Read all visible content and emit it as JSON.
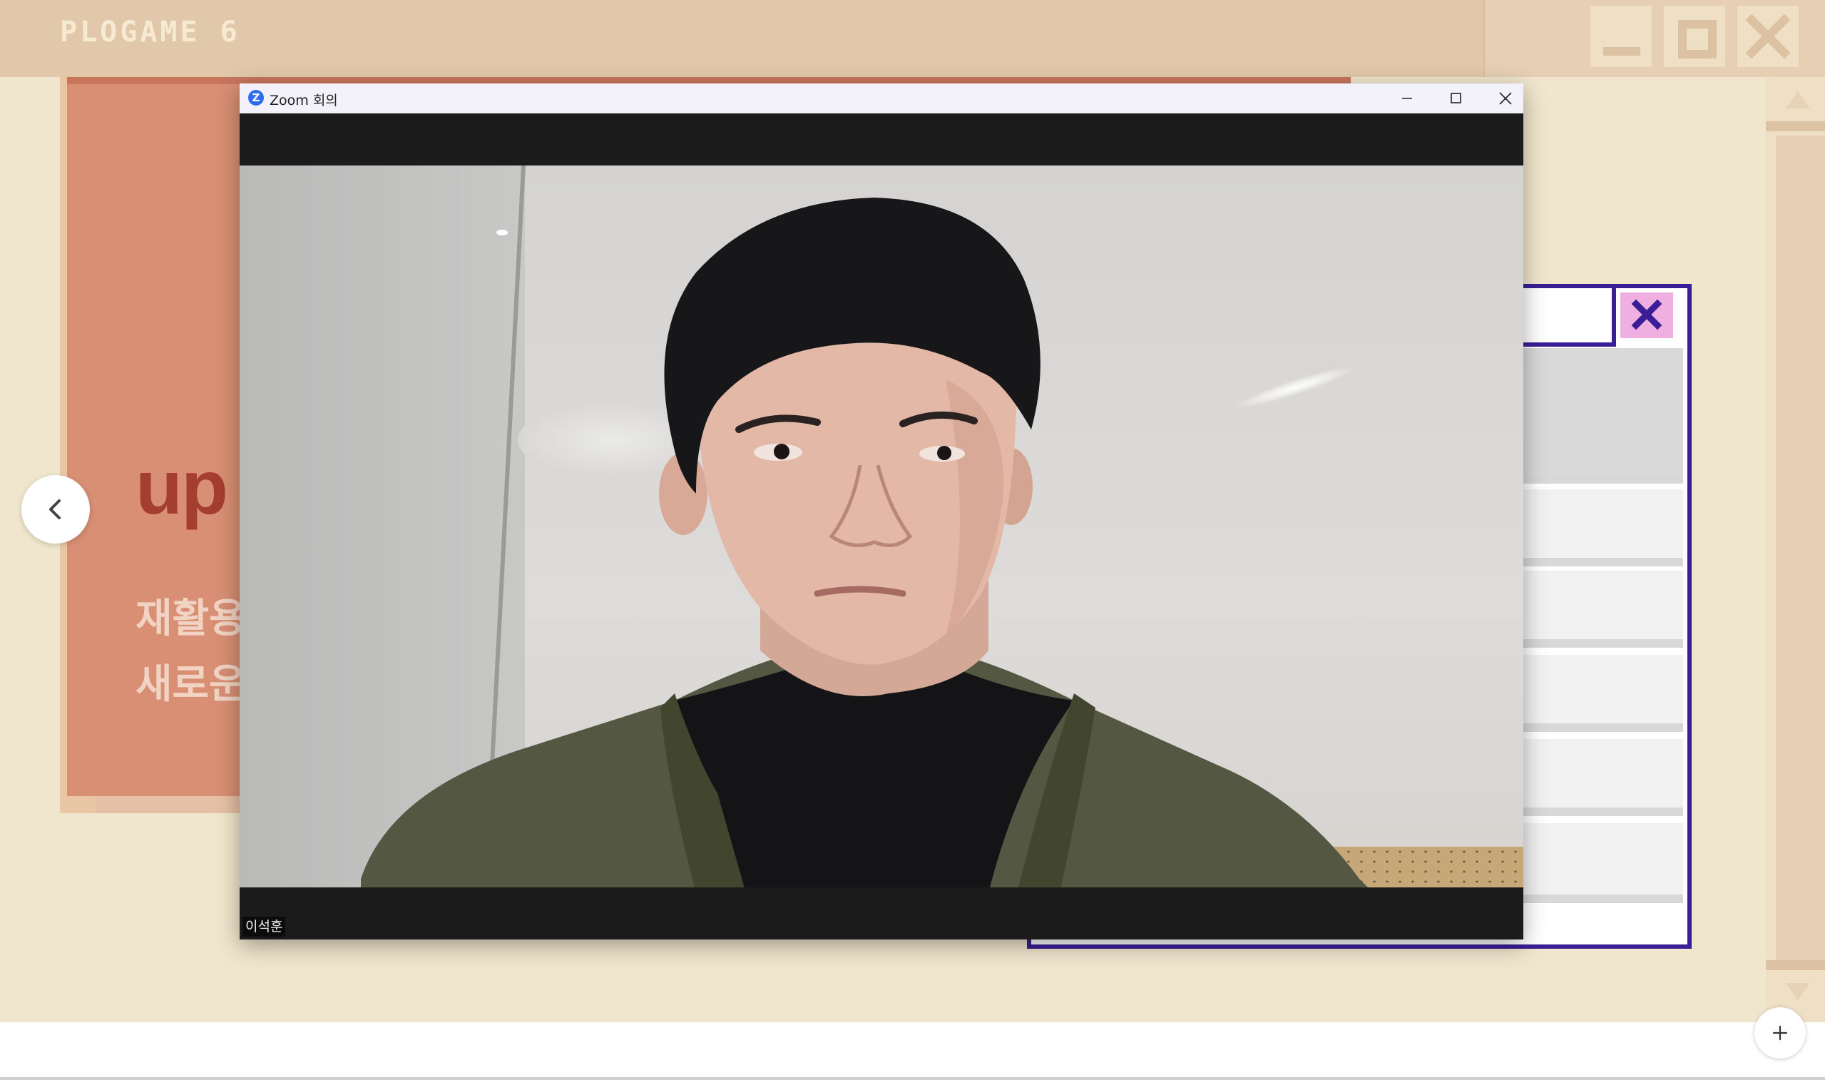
{
  "presentation": {
    "title": "PLOGAME 6",
    "heading": "up",
    "line1": "재활용",
    "line2": "새로운",
    "controls": {
      "minimize_icon": "minimize-icon",
      "maximize_icon": "maximize-icon",
      "close_icon": "close-icon"
    },
    "colors": {
      "background": "#f0e6cd",
      "header": "#e2c8aa",
      "card": "#d88f74",
      "heading": "#a43e30",
      "dialog_border": "#3a1e96",
      "dialog_close": "#efb0e1"
    }
  },
  "zoom": {
    "window_title": "Zoom 회의",
    "logo_letter": "Z",
    "participant_name": "이석훈",
    "controls": [
      "minimize-icon",
      "maximize-icon",
      "close-icon"
    ]
  },
  "navigation": {
    "prev_icon": "chevron-left-icon",
    "add_icon": "plus-icon"
  }
}
